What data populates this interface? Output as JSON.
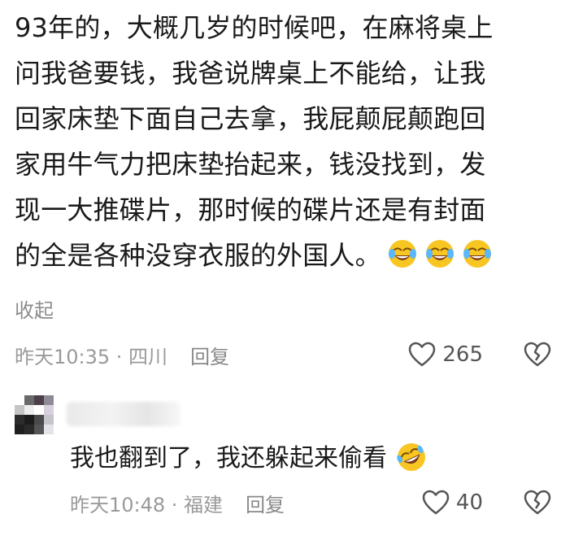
{
  "comment": {
    "lines": [
      "93年的，大概几岁的时候吧，在麻将桌上",
      "问我爸要钱，我爸说牌桌上不能给，让我",
      "回家床垫下面自己去拿，我屁颠屁颠跑回",
      "家用牛气力把床垫抬起来，钱没找到，发",
      "现一大推碟片，那时候的碟片还是有封面",
      "的全是各种没穿衣服的外国人。"
    ],
    "emojis": [
      "crying-laughing-emoji",
      "crying-laughing-emoji",
      "crying-laughing-emoji"
    ],
    "collapse_label": "收起",
    "time_location": "昨天10:35 · 四川",
    "reply_label": "回复",
    "like_count": "265"
  },
  "reply": {
    "text": "我也翻到了，我还躲起来偷看",
    "emoji": "rolling-laughing-emoji",
    "time_location": "昨天10:48 · 福建",
    "reply_label": "回复",
    "like_count": "40"
  },
  "colors": {
    "text": "#1a1a1a",
    "meta": "#9a9a9a",
    "emoji_face": "#f7c623"
  }
}
